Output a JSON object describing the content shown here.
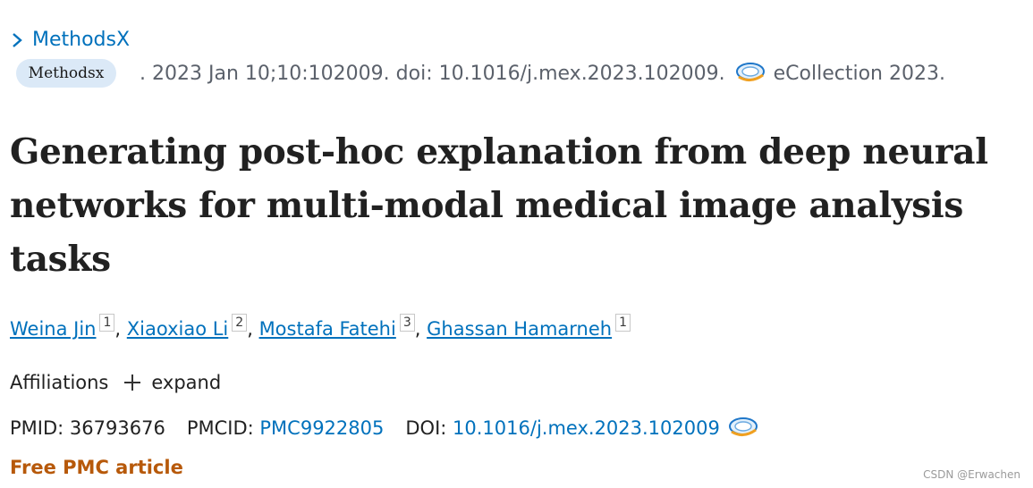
{
  "journal": {
    "name": "MethodsX",
    "badge": "Methodsx"
  },
  "citation": {
    "text": ". 2023 Jan 10;10:102009. doi: 10.1016/j.mex.2023.102009.",
    "collection": "eCollection 2023."
  },
  "article": {
    "title": "Generating post-hoc explanation from deep neural networks for multi-modal medical image analysis tasks"
  },
  "authors": [
    {
      "name": "Weina Jin",
      "affiliation": "1"
    },
    {
      "name": "Xiaoxiao Li",
      "affiliation": "2"
    },
    {
      "name": "Mostafa Fatehi",
      "affiliation": "3"
    },
    {
      "name": "Ghassan Hamarneh",
      "affiliation": "1"
    }
  ],
  "author_separator": ",",
  "affiliations": {
    "label": "Affiliations",
    "expand_label": "expand",
    "icon": "plus-icon"
  },
  "identifiers": {
    "pmid_label": "PMID:",
    "pmid": "36793676",
    "pmcid_label": "PMCID:",
    "pmcid": "PMC9922805",
    "doi_label": "DOI:",
    "doi": "10.1016/j.mex.2023.102009"
  },
  "free_article": "Free PMC article",
  "watermark": "CSDN @Erwachen",
  "colors": {
    "link": "#0071bc",
    "free_article": "#b7590a",
    "badge_background": "#dbe9f7",
    "citation_text": "#5b616b"
  }
}
